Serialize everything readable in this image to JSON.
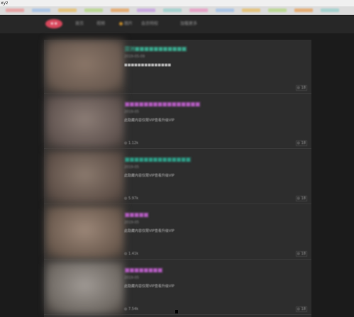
{
  "window": {
    "title": "xyz"
  },
  "bookmarks_colors": [
    "#e9a0a0",
    "#a6c4e8",
    "#e6c274",
    "#b9d88e",
    "#e6a86a",
    "#c9a6e2",
    "#9fd2cf",
    "#e9a0c6",
    "#a6c4e8",
    "#e6c274",
    "#b9d88e",
    "#e6a86a",
    "#9fd2cf"
  ],
  "nav": {
    "logo": "★★",
    "items": [
      "首页",
      "视频",
      "图片",
      "会员特权",
      "加载更多"
    ]
  },
  "cards": [
    {
      "title": "亚洲■■■■■■■■■■■",
      "title_color": "#3aa88e",
      "meta": "2019-05-09",
      "desc": "■■■■■■■■■■■■■■",
      "views": "",
      "count": "18",
      "thumb": [
        "#8a7668",
        "#6a5a50"
      ]
    },
    {
      "title": "■■■■■■■■■■■■■■■■",
      "title_color": "#b35cc0",
      "meta": "2019-05",
      "desc": "此隐藏内容仅限VIP查看升级VIP",
      "views": "1.12k",
      "count": "18",
      "thumb": [
        "#8c7d76",
        "#615450"
      ]
    },
    {
      "title": "■■■■■■■■■■■■■■",
      "title_color": "#2e9c86",
      "meta": "2019-05",
      "desc": "此隐藏内容仅限VIP查看升级VIP",
      "views": "5.97k",
      "count": "18",
      "thumb": [
        "#8b7a6e",
        "#5f5048"
      ]
    },
    {
      "title": "■■■■■",
      "title_color": "#b35cc0",
      "meta": "2019-05",
      "desc": "此隐藏内容仅限VIP查看升级VIP",
      "views": "1.41k",
      "count": "18",
      "thumb": [
        "#9c8778",
        "#6b5a4e"
      ]
    },
    {
      "title": "■■■■■■■■",
      "title_color": "#b35cc0",
      "meta": "2019-05",
      "desc": "此隐藏内容仅限VIP查看升级VIP",
      "views": "7.54k",
      "count": "18",
      "thumb": [
        "#a09a95",
        "#6e6862"
      ]
    }
  ]
}
